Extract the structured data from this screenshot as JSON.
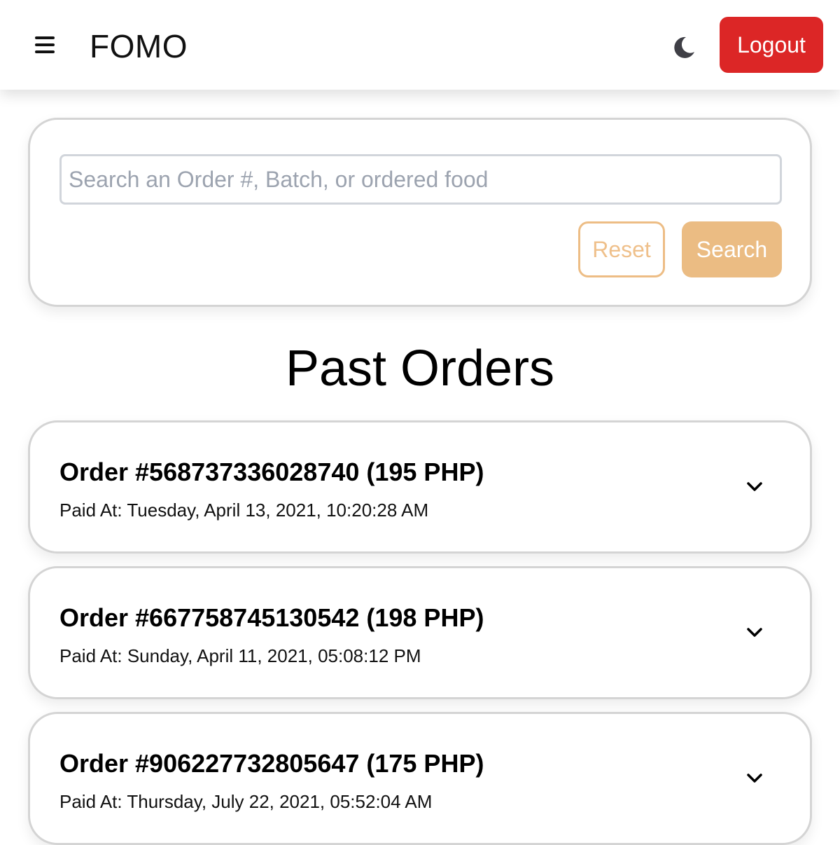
{
  "header": {
    "brand": "FOMO",
    "logout_label": "Logout",
    "menu_icon": "hamburger-menu-icon",
    "theme_icon": "moon-icon"
  },
  "search": {
    "placeholder": "Search an Order #, Batch, or ordered food",
    "value": "",
    "reset_label": "Reset",
    "search_label": "Search"
  },
  "page": {
    "title": "Past Orders"
  },
  "orders": [
    {
      "title": "Order #568737336028740 (195 PHP)",
      "paid_at": "Paid At: Tuesday, April 13, 2021, 10:20:28 AM"
    },
    {
      "title": "Order #667758745130542 (198 PHP)",
      "paid_at": "Paid At: Sunday, April 11, 2021, 05:08:12 PM"
    },
    {
      "title": "Order #906227732805647 (175 PHP)",
      "paid_at": "Paid At: Thursday, July 22, 2021, 05:52:04 AM"
    }
  ],
  "colors": {
    "logout": "#dc2626",
    "accent": "#ebbc83",
    "card_border": "#d4d4d4"
  }
}
